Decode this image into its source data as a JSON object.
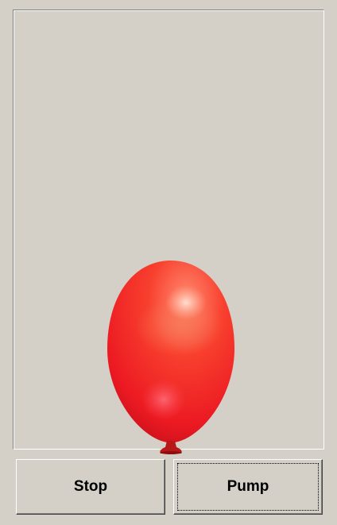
{
  "stage": {
    "balloon": {
      "color": "#ee1c24",
      "highlight_color": "#f7a98a",
      "knot_color": "#b81818"
    }
  },
  "buttons": {
    "stop_label": "Stop",
    "pump_label": "Pump",
    "focused": "pump"
  }
}
